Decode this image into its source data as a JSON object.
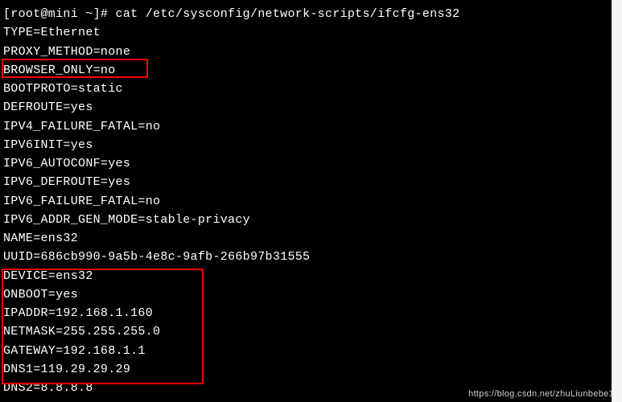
{
  "terminal": {
    "prompt": "[root@mini ~]# ",
    "command": "cat /etc/sysconfig/network-scripts/ifcfg-ens32",
    "lines": [
      "TYPE=Ethernet",
      "PROXY_METHOD=none",
      "BROWSER_ONLY=no",
      "BOOTPROTO=static",
      "DEFROUTE=yes",
      "IPV4_FAILURE_FATAL=no",
      "IPV6INIT=yes",
      "IPV6_AUTOCONF=yes",
      "IPV6_DEFROUTE=yes",
      "IPV6_FAILURE_FATAL=no",
      "IPV6_ADDR_GEN_MODE=stable-privacy",
      "NAME=ens32",
      "UUID=686cb990-9a5b-4e8c-9afb-266b97b31555",
      "DEVICE=ens32",
      "ONBOOT=yes",
      "IPADDR=192.168.1.160",
      "NETMASK=255.255.255.0",
      "GATEWAY=192.168.1.1",
      "DNS1=119.29.29.29",
      "DNS2=8.8.8.8"
    ]
  },
  "highlights": {
    "box1_annotation": "BOOTPROTO=static",
    "box2_annotation_start": "ONBOOT=yes",
    "box2_annotation_end": "DNS2=8.8.8.8"
  },
  "watermark": "https://blog.csdn.net/zhuLiunbebe1"
}
